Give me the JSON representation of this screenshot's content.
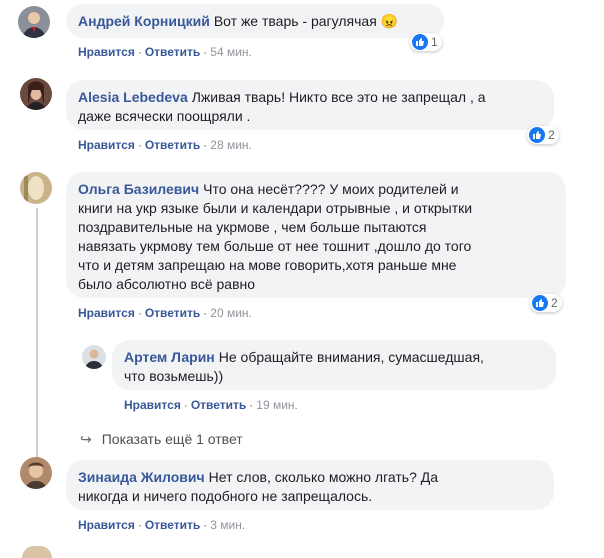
{
  "comments": [
    {
      "author": "Андрей Корницкий",
      "text": "Вот же тварь - рагулячая 😠",
      "like_label": "Нравится",
      "reply_label": "Ответить",
      "time": "54 мин.",
      "reactions": "1"
    },
    {
      "author": "Alesia Lebedeva",
      "text": "Лживая тварь! Никто все это не запрещал , а\nдаже всячески поощряли .",
      "like_label": "Нравится",
      "reply_label": "Ответить",
      "time": "28 мин.",
      "reactions": "2"
    },
    {
      "author": "Ольга Базилевич",
      "text": "Что она несёт???? У моих родителей и\nкниги на укр языке были и календари отрывные , и открытки\nпоздравительные на укрмове , чем больше пытаются\nнавязать укрмову тем больше от нее тошнит ,дошло до того\nчто и детям запрещаю на мове говорить,хотя раньше мне\nбыло абсолютно всё равно",
      "like_label": "Нравится",
      "reply_label": "Ответить",
      "time": "20 мин.",
      "reactions": "2"
    }
  ],
  "reply": {
    "author": "Артем Ларин",
    "text": "Не обращайте внимания, сумасшедшая,\nчто возьмешь))",
    "like_label": "Нравится",
    "reply_label": "Ответить",
    "time": "19 мин."
  },
  "more_replies": {
    "arrow": "↪",
    "label": "Показать ещё 1 ответ"
  },
  "last_comment": {
    "author": "Зинаида Жилович",
    "text": "Нет слов, сколько можно лгать? Да\nникогда и ничего подобного не запрещалось.",
    "like_label": "Нравится",
    "reply_label": "Ответить",
    "time": "3 мин."
  },
  "separator": "·",
  "colors": {
    "link": "#385898",
    "bubble": "#f2f3f5",
    "like_blue": "#1877f2"
  }
}
